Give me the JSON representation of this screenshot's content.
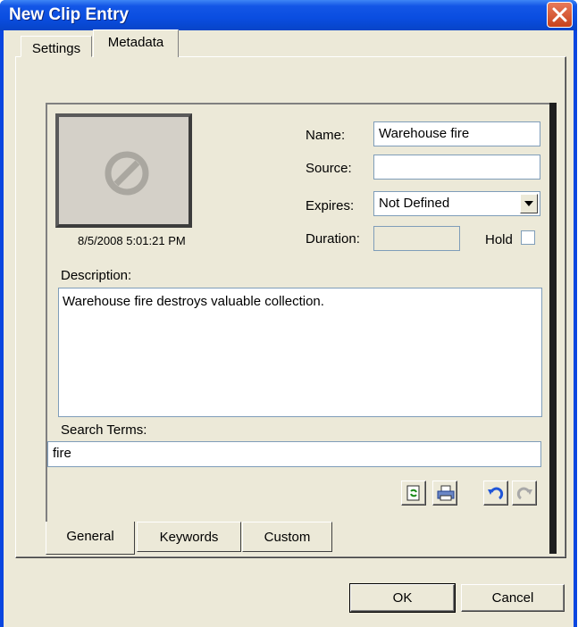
{
  "window": {
    "title": "New Clip Entry",
    "accent": "#0a46e0"
  },
  "tabs": [
    {
      "label": "Settings"
    },
    {
      "label": "Metadata"
    }
  ],
  "thumbnail": {
    "icon": "no-symbol-icon",
    "timestamp": "8/5/2008 5:01:21 PM"
  },
  "fields": {
    "name": {
      "label": "Name:",
      "value": "Warehouse fire"
    },
    "source": {
      "label": "Source:",
      "value": ""
    },
    "expires": {
      "label": "Expires:",
      "value": "Not Defined"
    },
    "duration": {
      "label": "Duration:",
      "value": ""
    },
    "hold": {
      "label": "Hold",
      "checked": false
    }
  },
  "description": {
    "label": "Description:",
    "value": "Warehouse fire destroys valuable collection."
  },
  "search_terms": {
    "label": "Search Terms:",
    "value": "fire"
  },
  "toolbar": [
    "refresh-icon",
    "print-icon",
    "undo-icon",
    "redo-icon"
  ],
  "bottom_tabs": [
    {
      "label": "General"
    },
    {
      "label": "Keywords"
    },
    {
      "label": "Custom"
    }
  ],
  "buttons": {
    "ok": "OK",
    "cancel": "Cancel"
  }
}
